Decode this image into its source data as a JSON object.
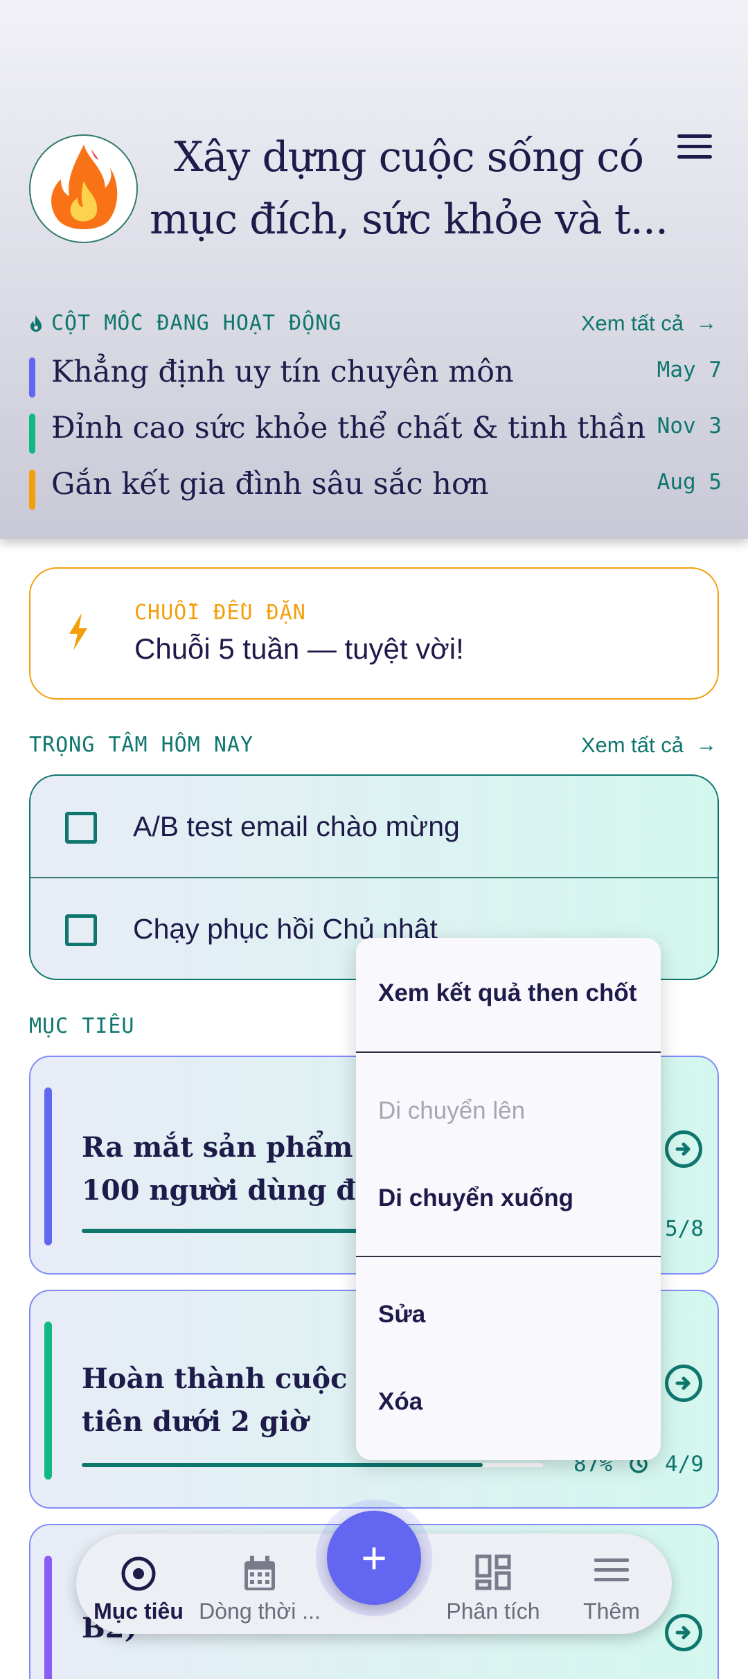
{
  "header": {
    "title": "Xây dựng cuộc sống có mục đích, sức khỏe và t...",
    "icon": "fire-icon",
    "menu_icon": "hamburger-menu-icon"
  },
  "milestones": {
    "label": "CỘT MỐC ĐANG HOẠT ĐỘNG",
    "see_all": "Xem tất cả",
    "items": [
      {
        "text": "Khẳng định uy tín chuyên môn",
        "date": "May 7",
        "color": "#6366f1"
      },
      {
        "text": "Đỉnh cao sức khỏe thể chất & tinh thần",
        "date": "Nov 3",
        "color": "#10b981"
      },
      {
        "text": "Gắn kết gia đình sâu sắc hơn",
        "date": "Aug 5",
        "color": "#f59e0b"
      }
    ]
  },
  "streak": {
    "kicker": "CHUỖI ĐỀU ĐẶN",
    "message": "Chuỗi 5 tuần — tuyệt vời!",
    "color": "#f59e0b"
  },
  "focus": {
    "label": "TRỌNG TÂM HÔM NAY",
    "see_all": "Xem tất cả",
    "items": [
      {
        "text": "A/B test email chào mừng",
        "checked": false
      },
      {
        "text": "Chạy phục hồi Chủ nhật",
        "checked": false
      }
    ]
  },
  "goals": {
    "label": "MỤC TIÊU",
    "items": [
      {
        "line1": "Ra mắt sản phẩm MV",
        "line2": "100 người dùng đầu",
        "stats": "5/8",
        "progress": 0.62,
        "color": "#6366f1"
      },
      {
        "line1": "Hoàn thành cuộc ch",
        "line2": "tiên dưới 2 giờ",
        "percent": "87%",
        "stats": "4/9",
        "progress": 0.87,
        "color": "#10b981"
      },
      {
        "line1": "",
        "line2": "B2)",
        "color": "#8b5cf6"
      }
    ]
  },
  "popup_menu": {
    "items": [
      {
        "label": "Xem kết quả then chốt",
        "enabled": true
      },
      {
        "label": "Di chuyển lên",
        "enabled": false
      },
      {
        "label": "Di chuyển xuống",
        "enabled": true
      },
      {
        "label": "Sửa",
        "enabled": true
      },
      {
        "label": "Xóa",
        "enabled": true
      }
    ]
  },
  "nav": {
    "items": [
      {
        "label": "Mục tiêu",
        "icon": "target-icon",
        "active": true
      },
      {
        "label": "Dòng thời ...",
        "icon": "calendar-icon",
        "active": false
      },
      {
        "label": "Phân tích",
        "icon": "dashboard-icon",
        "active": false
      },
      {
        "label": "Thêm",
        "icon": "menu-icon",
        "active": false
      }
    ],
    "fab_label": "+",
    "fab_color": "#6366f1"
  }
}
